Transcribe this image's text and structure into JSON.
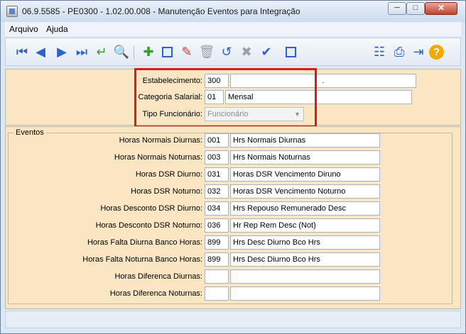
{
  "window": {
    "title": "06.9.5585 - PE0300 - 1.02.00.008 - Manutenção Eventos para Integração",
    "controls": {
      "minimize": "─",
      "maximize": "□",
      "close": "✕"
    }
  },
  "menu": {
    "arquivo": "Arquivo",
    "ajuda": "Ajuda"
  },
  "toolbar": {
    "icons": [
      "first-icon",
      "previous-icon",
      "next-icon",
      "last-icon",
      "go-to-icon",
      "search-icon",
      "add-icon",
      "copy-icon",
      "edit-icon",
      "delete-icon",
      "undo-icon",
      "cancel-icon",
      "save-icon",
      "duplicate-icon",
      "tree-icon",
      "print-icon",
      "exit-icon",
      "help-icon"
    ]
  },
  "header": {
    "estabelecimento": {
      "label": "Estabelecimento:",
      "code": "300",
      "description": "."
    },
    "categoria": {
      "label": "Categoria Salarial:",
      "code": "01",
      "description": "Mensal"
    },
    "tipo": {
      "label": "Tipo Funcionário:",
      "value": "Funcionário"
    }
  },
  "eventos": {
    "title": "Eventos",
    "rows": [
      {
        "label": "Horas Normais Diurnas:",
        "code": "001",
        "description": "Hrs Normais Diurnas"
      },
      {
        "label": "Horas Normais Noturnas:",
        "code": "003",
        "description": "Hrs Normais Noturnas"
      },
      {
        "label": "Horas DSR Diurno:",
        "code": "031",
        "description": "Horas DSR Vencimento Diruno"
      },
      {
        "label": "Horas DSR Noturno:",
        "code": "032",
        "description": "Horas DSR Vencimento Noturno"
      },
      {
        "label": "Horas Desconto DSR Diurno:",
        "code": "034",
        "description": "Hrs Repouso Remunerado Desc"
      },
      {
        "label": "Horas Desconto DSR Noturno:",
        "code": "036",
        "description": "Hr Rep Rem Desc (Not)"
      },
      {
        "label": "Horas Falta Diurna Banco Horas:",
        "code": "899",
        "description": "Hrs Desc Diurno Bco Hrs"
      },
      {
        "label": "Horas Falta Noturna Banco Horas:",
        "code": "899",
        "description": "Hrs Desc Diurno Bco Hrs"
      },
      {
        "label": "Horas Diferenca Diurnas:",
        "code": "",
        "description": ""
      },
      {
        "label": "Horas Diferenca Noturnas:",
        "code": "",
        "description": ""
      }
    ]
  },
  "colors": {
    "highlight": "#e0171c",
    "panel": "#fbe6c3"
  }
}
